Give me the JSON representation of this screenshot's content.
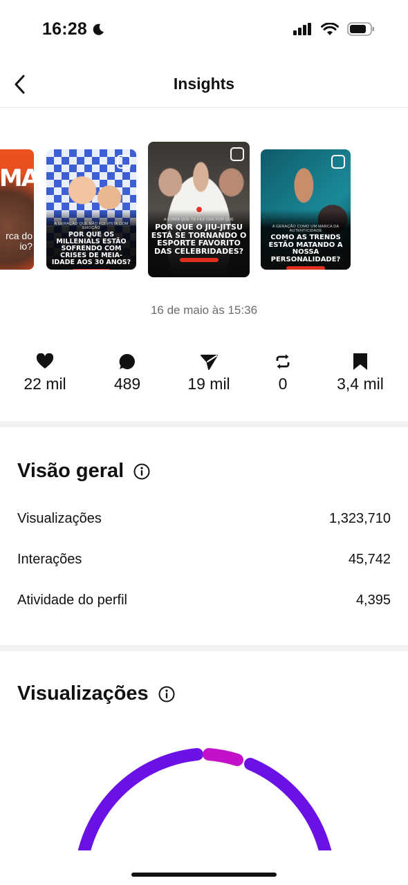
{
  "status_bar": {
    "time": "16:28"
  },
  "header": {
    "title": "Insights"
  },
  "carousel": [
    {
      "headline": "rca do io?",
      "kicker": ""
    },
    {
      "headline": "POR QUE OS MILLENIALS ESTÃO SOFRENDO COM CRISES DE MEIA-IDADE AOS 30 ANOS?",
      "kicker": "A GERAÇÃO QUE NÃO FOI VISTA COM EMOÇÃO"
    },
    {
      "headline": "POR QUE O JIU-JITSU ESTÁ SE TORNANDO O ESPORTE FAVORITO DAS CELEBRIDADES?",
      "kicker": "A ETAPA QUE TE FEZ VER POR QUÊ"
    },
    {
      "headline": "COMO AS TRENDS ESTÃO MATANDO A NOSSA PERSONALIDADE?",
      "kicker": "A GERAÇÃO COMO UM MARCA DA AUTENTICIDADE"
    }
  ],
  "post_date": "16 de maio às 15:36",
  "stats": [
    {
      "icon": "heart-icon",
      "value": "22 mil"
    },
    {
      "icon": "comment-icon",
      "value": "489"
    },
    {
      "icon": "share-icon",
      "value": "19 mil"
    },
    {
      "icon": "repost-icon",
      "value": "0"
    },
    {
      "icon": "bookmark-icon",
      "value": "3,4 mil"
    }
  ],
  "overview": {
    "title": "Visão geral",
    "rows": [
      {
        "label": "Visualizações",
        "value": "1,323,710"
      },
      {
        "label": "Interações",
        "value": "45,742"
      },
      {
        "label": "Atividade do perfil",
        "value": "4,395"
      }
    ]
  },
  "views_section": {
    "title": "Visualizações"
  },
  "colors": {
    "gauge_primary": "#6a12e6",
    "gauge_secondary": "#c311c9"
  }
}
